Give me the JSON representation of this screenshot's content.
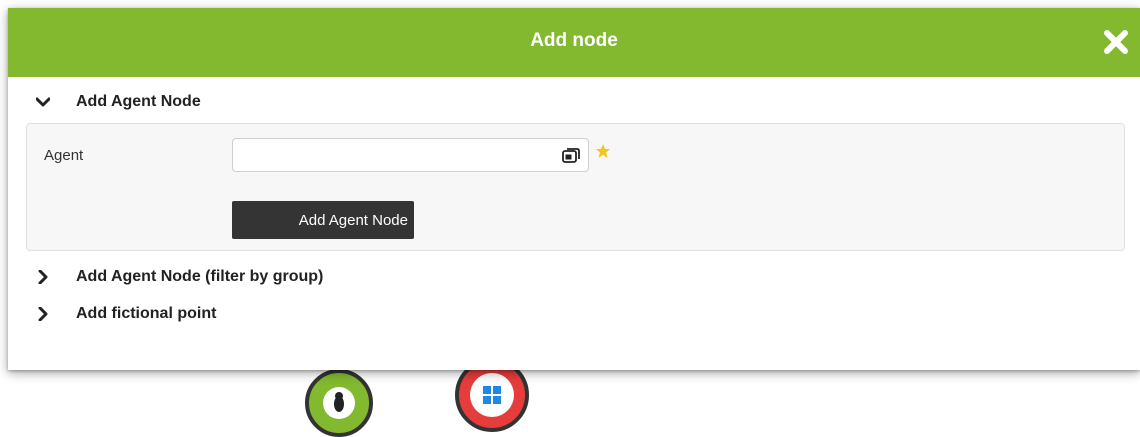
{
  "dialog": {
    "title": "Add node",
    "close_icon": "close-icon"
  },
  "sections": [
    {
      "label": "Add Agent Node",
      "expanded": true,
      "icon": "chevron-down-icon"
    },
    {
      "label": "Add Agent Node (filter by group)",
      "expanded": false,
      "icon": "chevron-right-icon"
    },
    {
      "label": "Add fictional point",
      "expanded": false,
      "icon": "chevron-right-icon"
    }
  ],
  "agent_form": {
    "field_label": "Agent",
    "input_value": "",
    "input_icon": "agent-select-icon",
    "required_icon": "required-star-icon",
    "submit_label": "Add Agent Node"
  },
  "background": {
    "nodes": [
      {
        "icon": "linux-icon",
        "color": "#82b92e"
      },
      {
        "icon": "windows-icon",
        "color": "#e63c3c"
      }
    ]
  },
  "colors": {
    "accent": "#82b92e",
    "button": "#343434",
    "star": "#f5c518",
    "windows_ring": "#e63c3c"
  }
}
